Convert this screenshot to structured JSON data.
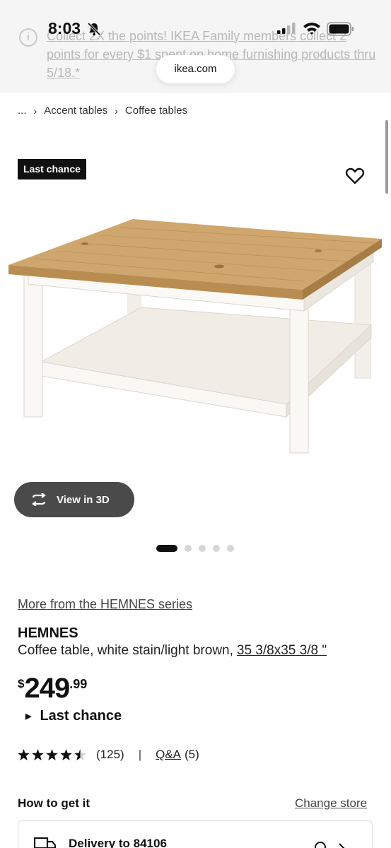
{
  "status_bar": {
    "time": "8:03"
  },
  "banner": {
    "text": "Collect 2X the points! IKEA Family members collect 2 points for every $1 spent on home furnishing products thru 5/18.*"
  },
  "browser": {
    "url": "ikea.com"
  },
  "breadcrumb": {
    "ellipsis": "...",
    "items": [
      "Accent tables",
      "Coffee tables"
    ]
  },
  "product": {
    "badge": "Last chance",
    "view_3d_label": "View in 3D",
    "image_dots": {
      "count": 5,
      "active_index": 0
    },
    "series_link": "More from the HEMNES series",
    "name": "HEMNES",
    "description": "Coffee table, white stain/light brown,",
    "size": "35 3/8x35 3/8 \"",
    "price": {
      "currency": "$",
      "dollars": "249",
      "cents": ".99"
    },
    "availability": "Last chance",
    "rating": {
      "stars": 4.5,
      "count": "(125)",
      "separator": "|",
      "qa_label": "Q&A",
      "qa_count": "(5)"
    }
  },
  "fulfillment": {
    "title": "How to get it",
    "change_store": "Change store",
    "delivery_label": "Delivery to 84106"
  },
  "colors": {
    "badge_bg": "#111111",
    "view3d_bg": "#4a4a4a",
    "banner_bg": "#f5f5f5",
    "wood": "#c9a06a"
  }
}
